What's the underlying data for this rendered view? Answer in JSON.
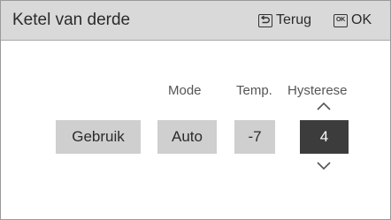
{
  "header": {
    "title": "Ketel van derde",
    "back_label": "Terug",
    "ok_icon_text": "OK",
    "ok_label": "OK"
  },
  "columns": {
    "mode_label": "Mode",
    "temp_label": "Temp.",
    "hysteresis_label": "Hysterese"
  },
  "fields": {
    "usage": "Gebruik",
    "mode": "Auto",
    "temp": "-7",
    "hysteresis": "4"
  },
  "icons": {
    "back": "return-arrow-icon",
    "ok": "ok-key-icon",
    "increase": "chevron-up-icon",
    "decrease": "chevron-down-icon"
  },
  "colors": {
    "header_bg": "#d9d9d9",
    "field_bg": "#cfcfcf",
    "selected_field_bg": "#3c3c3c",
    "selected_field_text": "#ffffff"
  }
}
